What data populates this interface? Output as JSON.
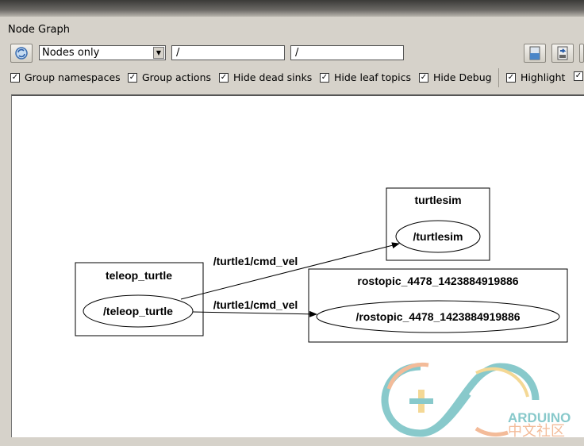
{
  "window": {
    "title": "Node Graph"
  },
  "toolbar": {
    "refresh_icon": "refresh-icon",
    "mode_select": "Nodes only",
    "filter1": "/",
    "filter2": "/",
    "save_icon": "save-icon",
    "export_icon": "export-icon"
  },
  "options": [
    {
      "label": "Group namespaces",
      "checked": true
    },
    {
      "label": "Group actions",
      "checked": true
    },
    {
      "label": "Hide dead sinks",
      "checked": true
    },
    {
      "label": "Hide leaf topics",
      "checked": true
    },
    {
      "label": "Hide Debug",
      "checked": true
    },
    {
      "label": "Highlight",
      "checked": true
    }
  ],
  "graph": {
    "nodes": [
      {
        "cluster": "teleop_turtle",
        "node": "/teleop_turtle"
      },
      {
        "cluster": "turtlesim",
        "node": "/turtlesim"
      },
      {
        "cluster": "rostopic_4478_1423884919886",
        "node": "/rostopic_4478_1423884919886"
      }
    ],
    "edges": [
      {
        "label": "/turtle1/cmd_vel",
        "from": "/teleop_turtle",
        "to": "/turtlesim"
      },
      {
        "label": "/turtle1/cmd_vel",
        "from": "/teleop_turtle",
        "to": "/rostopic_4478_1423884919886"
      }
    ]
  },
  "watermark": {
    "text1": "ARDUINO",
    "text2": "中文社区",
    "colors": [
      "#7cc4c6",
      "#f2b48e",
      "#f3d48a"
    ]
  }
}
